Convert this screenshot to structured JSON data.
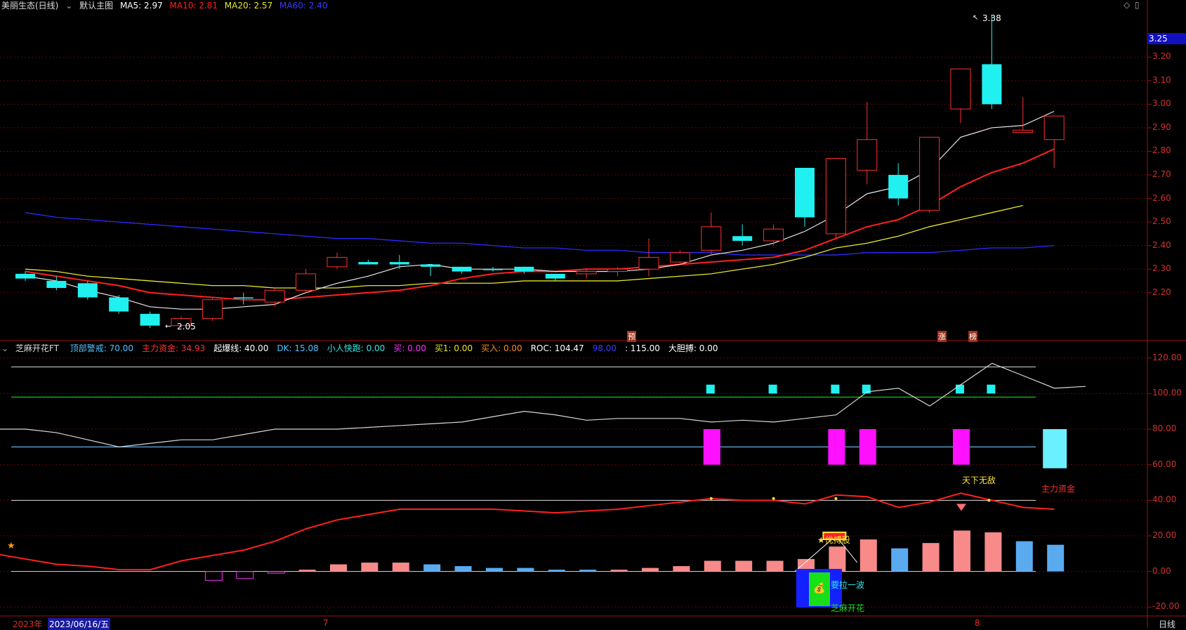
{
  "header": {
    "title": "美丽生态(日线)",
    "chart_name": "默认主图",
    "ma5": "MA5: 2.97",
    "ma10": "MA10: 2.81",
    "ma20": "MA20: 2.57",
    "ma60": "MA60: 2.40",
    "colors": {
      "ma5": "#ffffff",
      "ma10": "#ff2020",
      "ma20": "#e6e62e",
      "ma60": "#3a3aff"
    }
  },
  "price_axis": {
    "current_badge": "3.25",
    "labels": [
      "3.20",
      "3.10",
      "3.00",
      "2.90",
      "2.80",
      "2.70",
      "2.60",
      "2.50",
      "2.40",
      "2.30",
      "2.20"
    ],
    "high_label": "3.38",
    "low_label": "2.05",
    "markers": [
      "预",
      "涨",
      "榜"
    ]
  },
  "indicator_header": {
    "name": "芝麻开花FT",
    "items": [
      {
        "text": "顶部警戒: 70.00",
        "color": "#4fc3ff"
      },
      {
        "text": "主力资金: 34.93",
        "color": "#ff3030"
      },
      {
        "text": "起爆线: 40.00",
        "color": "#ffffff"
      },
      {
        "text": "DK: 15.08",
        "color": "#4fc3ff"
      },
      {
        "text": "小人快跑: 0.00",
        "color": "#2ee6e6"
      },
      {
        "text": "买: 0.00",
        "color": "#ff30ff"
      },
      {
        "text": "买1: 0.00",
        "color": "#e6e62e"
      },
      {
        "text": "买入: 0.00",
        "color": "#ff8c1a"
      },
      {
        "text": "ROC: 104.47",
        "color": "#ffffff"
      },
      {
        "text": "98.00",
        "color": "#3a3aff"
      },
      {
        "text": ": 115.00",
        "color": "#ffffff"
      },
      {
        "text": "大胆搏: 0.00",
        "color": "#ffffff"
      }
    ]
  },
  "indicator_axis": {
    "labels": [
      "120.00",
      "100.00",
      "80.00",
      "60.00",
      "40.00",
      "20.00",
      "0.00",
      "-20.00"
    ]
  },
  "annotations": {
    "tianxia": "天下无敌",
    "zhuli": "主力资金",
    "youbo": "★优搏股",
    "yaola": "要拉一波",
    "zhima": "芝麻开花"
  },
  "bottom": {
    "year": "2023年",
    "date": "2023/06/16/五",
    "m7": "7",
    "m8": "8",
    "period": "日线"
  },
  "chart_data": {
    "type": "candlestick",
    "ylim": [
      2.05,
      3.4
    ],
    "candles": [
      [
        2.26,
        2.28,
        2.29,
        2.25,
        "c"
      ],
      [
        2.25,
        2.22,
        2.27,
        2.21,
        "c"
      ],
      [
        2.24,
        2.18,
        2.25,
        2.17,
        "c"
      ],
      [
        2.18,
        2.12,
        2.19,
        2.11,
        "c"
      ],
      [
        2.11,
        2.06,
        2.12,
        2.05,
        "c"
      ],
      [
        2.06,
        2.09,
        2.1,
        2.05,
        "r"
      ],
      [
        2.09,
        2.17,
        2.18,
        2.08,
        "r"
      ],
      [
        2.18,
        2.18,
        2.2,
        2.15,
        "c"
      ],
      [
        2.16,
        2.21,
        2.22,
        2.14,
        "r"
      ],
      [
        2.21,
        2.28,
        2.3,
        2.2,
        "r"
      ],
      [
        2.31,
        2.35,
        2.37,
        2.3,
        "r"
      ],
      [
        2.33,
        2.32,
        2.34,
        2.32,
        "c"
      ],
      [
        2.33,
        2.32,
        2.36,
        2.3,
        "c"
      ],
      [
        2.32,
        2.31,
        2.32,
        2.27,
        "c"
      ],
      [
        2.31,
        2.29,
        2.31,
        2.28,
        "c"
      ],
      [
        2.3,
        2.3,
        2.31,
        2.29,
        "c"
      ],
      [
        2.31,
        2.29,
        2.31,
        2.28,
        "c"
      ],
      [
        2.28,
        2.26,
        2.28,
        2.25,
        "c"
      ],
      [
        2.28,
        2.29,
        2.3,
        2.26,
        "r"
      ],
      [
        2.29,
        2.3,
        2.31,
        2.27,
        "r"
      ],
      [
        2.3,
        2.35,
        2.43,
        2.27,
        "r"
      ],
      [
        2.33,
        2.37,
        2.38,
        2.32,
        "r"
      ],
      [
        2.38,
        2.48,
        2.54,
        2.36,
        "r"
      ],
      [
        2.44,
        2.42,
        2.49,
        2.4,
        "c"
      ],
      [
        2.42,
        2.47,
        2.49,
        2.4,
        "r"
      ],
      [
        2.73,
        2.52,
        2.73,
        2.48,
        "c"
      ],
      [
        2.45,
        2.77,
        2.77,
        2.43,
        "r"
      ],
      [
        2.72,
        2.85,
        3.01,
        2.66,
        "r"
      ],
      [
        2.7,
        2.6,
        2.75,
        2.57,
        "c"
      ],
      [
        2.55,
        2.86,
        2.86,
        2.54,
        "r"
      ],
      [
        2.98,
        3.15,
        3.15,
        2.92,
        "r"
      ],
      [
        3.17,
        3.0,
        3.38,
        2.98,
        "c"
      ],
      [
        2.88,
        2.89,
        3.03,
        2.88,
        "r"
      ],
      [
        2.85,
        2.95,
        2.95,
        2.73,
        "r"
      ]
    ],
    "ma5": [
      2.27,
      2.25,
      2.21,
      2.18,
      2.14,
      2.13,
      2.13,
      2.14,
      2.15,
      2.2,
      2.24,
      2.27,
      2.31,
      2.32,
      2.3,
      2.3,
      2.3,
      2.29,
      2.29,
      2.29,
      2.3,
      2.32,
      2.36,
      2.38,
      2.41,
      2.46,
      2.53,
      2.62,
      2.65,
      2.72,
      2.86,
      2.9,
      2.91,
      2.97
    ],
    "ma10": [
      2.29,
      2.27,
      2.25,
      2.23,
      2.2,
      2.19,
      2.18,
      2.17,
      2.17,
      2.18,
      2.19,
      2.2,
      2.21,
      2.23,
      2.26,
      2.28,
      2.29,
      2.29,
      2.3,
      2.3,
      2.31,
      2.32,
      2.33,
      2.34,
      2.35,
      2.38,
      2.43,
      2.48,
      2.51,
      2.57,
      2.65,
      2.71,
      2.75,
      2.81
    ],
    "ma20": [
      2.3,
      2.29,
      2.27,
      2.26,
      2.25,
      2.24,
      2.23,
      2.23,
      2.22,
      2.22,
      2.22,
      2.23,
      2.23,
      2.24,
      2.24,
      2.24,
      2.25,
      2.25,
      2.25,
      2.25,
      2.26,
      2.27,
      2.28,
      2.3,
      2.32,
      2.35,
      2.39,
      2.41,
      2.44,
      2.48,
      2.51,
      2.54,
      2.57
    ],
    "ma60": [
      2.54,
      2.52,
      2.51,
      2.5,
      2.49,
      2.48,
      2.47,
      2.46,
      2.45,
      2.44,
      2.43,
      2.43,
      2.42,
      2.41,
      2.41,
      2.4,
      2.39,
      2.39,
      2.38,
      2.38,
      2.37,
      2.37,
      2.37,
      2.36,
      2.36,
      2.36,
      2.36,
      2.37,
      2.37,
      2.37,
      2.38,
      2.39,
      2.39,
      2.4
    ],
    "indicator": {
      "ylim": [
        -25,
        125
      ],
      "roc": [
        80,
        80,
        78,
        74,
        70,
        72,
        74,
        74,
        77,
        80,
        80,
        80,
        81,
        82,
        83,
        84,
        87,
        90,
        88,
        85,
        86,
        86,
        86,
        84,
        85,
        84,
        86,
        88,
        101,
        103,
        93,
        105,
        117,
        110,
        103,
        104
      ],
      "zhuli": [
        10,
        7,
        4,
        3,
        1,
        1,
        6,
        9,
        12,
        17,
        24,
        29,
        32,
        35,
        35,
        35,
        35,
        34,
        33,
        34,
        35,
        37,
        39,
        41,
        40,
        40,
        38,
        43,
        42,
        36,
        39,
        44,
        40,
        36,
        35
      ],
      "bars": [
        0,
        0,
        0,
        0,
        0,
        0,
        -5,
        -4,
        -1,
        1,
        4,
        5,
        5,
        4,
        3,
        2,
        2,
        1,
        1,
        1,
        2,
        3,
        6,
        6,
        6,
        7,
        14,
        18,
        13,
        16,
        23,
        22,
        17,
        15
      ],
      "bar_colors": [
        "r",
        "r",
        "r",
        "r",
        "r",
        "r",
        "m",
        "m",
        "m",
        "r",
        "r",
        "r",
        "r",
        "b",
        "b",
        "b",
        "b",
        "b",
        "b",
        "r",
        "r",
        "r",
        "r",
        "r",
        "r",
        "r",
        "r",
        "r",
        "b",
        "r",
        "r",
        "r",
        "b",
        "b"
      ]
    }
  }
}
